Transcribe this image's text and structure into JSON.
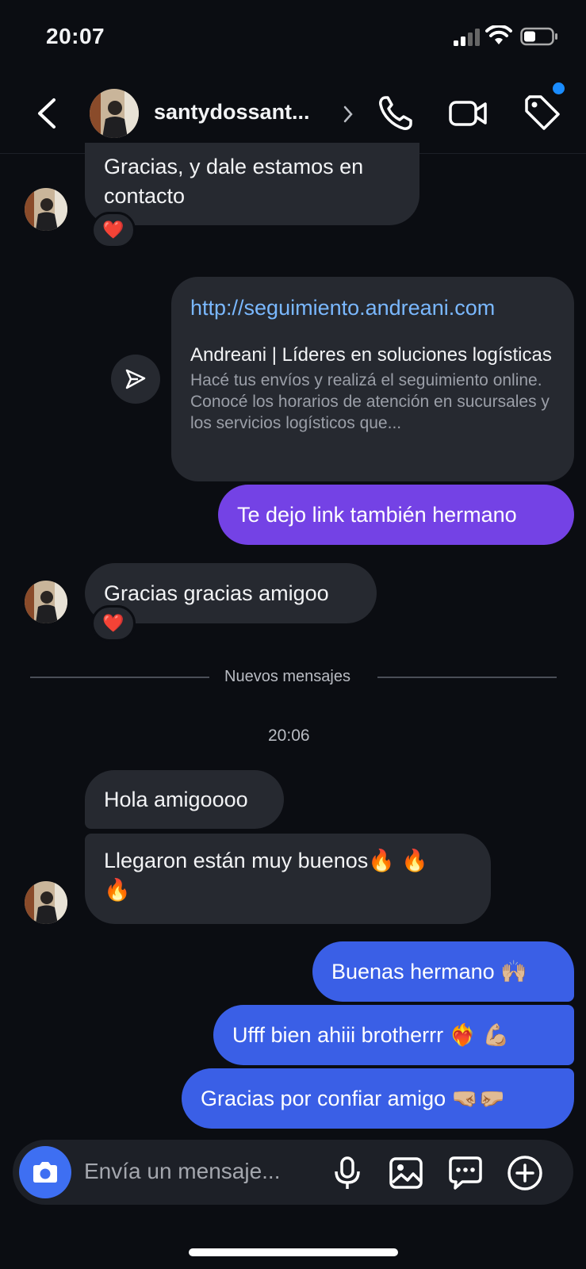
{
  "status_bar": {
    "time": "20:07"
  },
  "header": {
    "username": "santydossant..."
  },
  "messages": {
    "m1": {
      "text": "Gracias, y dale estamos en contacto",
      "reaction": "❤️"
    },
    "link": {
      "url": "http://seguimiento.andreani.com",
      "title": "Andreani | Líderes en soluciones logísticas",
      "description": "Hacé tus envíos y realizá el seguimiento online. Conocé los horarios de atención en sucursales y los servicios logísticos que..."
    },
    "m2": {
      "text": "Te dejo link también hermano"
    },
    "m3": {
      "text": "Gracias gracias amigoo",
      "reaction": "❤️"
    },
    "divider": "Nuevos mensajes",
    "timestamp": "20:06",
    "m4": {
      "text": "Hola amigoooo"
    },
    "m5": {
      "text": "Llegaron están muy buenos",
      "emoji1": "🔥 🔥",
      "emoji2": "🔥"
    },
    "m6": {
      "text": "Buenas hermano",
      "emoji": "🙌🏼"
    },
    "m7": {
      "text": "Ufff bien ahiii brotherrr",
      "emoji": "❤️‍🔥 💪🏼"
    },
    "m8": {
      "text": "Gracias por confiar amigo",
      "emoji": "🤜🏼🤛🏼"
    }
  },
  "composer": {
    "placeholder": "Envía un mensaje..."
  },
  "colors": {
    "accent_blue": "#3a5fe6",
    "accent_purple": "#7442e5",
    "link_blue": "#7ab8ff",
    "background": "#0b0d12",
    "incoming_bubble": "#262930"
  },
  "icons": [
    "signal-icon",
    "wifi-icon",
    "battery-icon",
    "back-arrow-icon",
    "chevron-right-icon",
    "phone-icon",
    "video-camera-icon",
    "tag-icon",
    "send-icon",
    "camera-icon",
    "microphone-icon",
    "image-icon",
    "chat-bubble-icon",
    "plus-circle-icon"
  ]
}
